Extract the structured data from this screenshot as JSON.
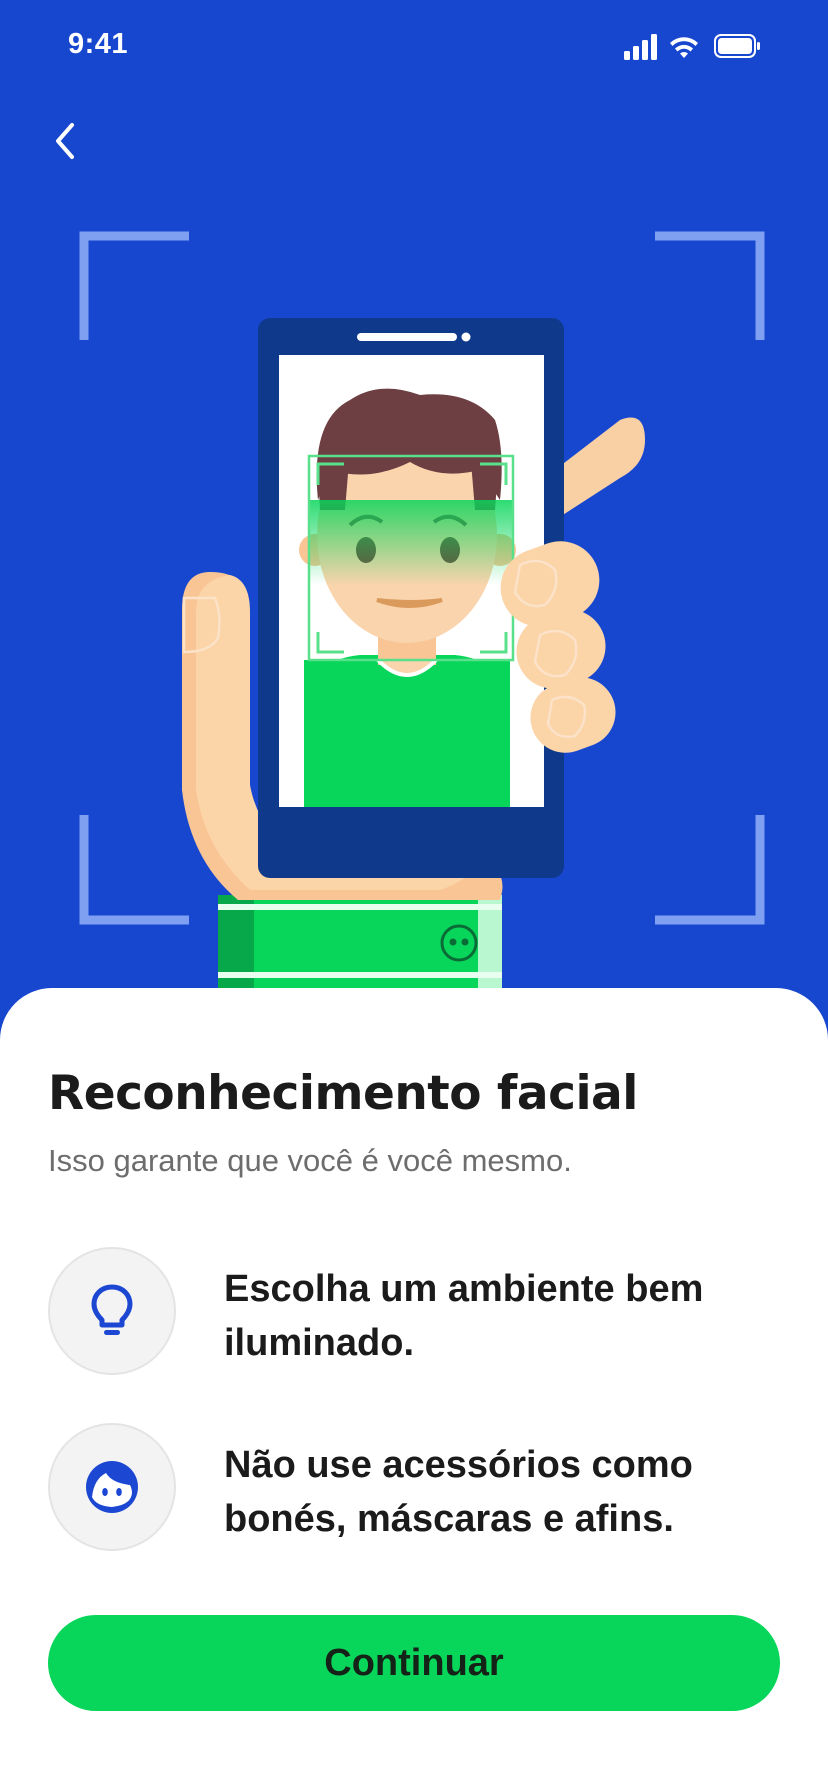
{
  "status_bar": {
    "time": "9:41",
    "icons": [
      "cellular-signal-icon",
      "wifi-icon",
      "battery-icon"
    ]
  },
  "navigation": {
    "back_icon": "chevron-left-icon"
  },
  "illustration": {
    "subject": "face-scan-illustration",
    "colors": {
      "background": "#1847cf",
      "phone": "#0f3a8c",
      "skin": "#f9ccA0",
      "hair": "#6e3f42",
      "shirt": "#08d65a",
      "scan_frame": "#7fa0f0"
    }
  },
  "content": {
    "title": "Reconhecimento facial",
    "subtitle": "Isso garante que você é você mesmo.",
    "tips": [
      {
        "icon": "lightbulb-icon",
        "text": "Escolha um ambiente bem iluminado."
      },
      {
        "icon": "face-icon",
        "text": "Não use acessórios como bonés, máscaras e afins."
      }
    ]
  },
  "actions": {
    "continue_label": "Continuar"
  },
  "colors": {
    "accent_green": "#08d65a",
    "brand_blue": "#1847cf",
    "icon_blue": "#1b47d2",
    "title_text": "#1b1b1b",
    "subtitle_text": "#6d6d6d"
  }
}
